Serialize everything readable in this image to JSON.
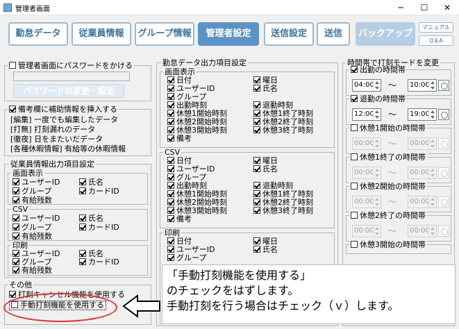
{
  "window": {
    "title": "管理者画面"
  },
  "toolbar": {
    "kintai": "勤怠データ",
    "employee": "従業員情報",
    "group": "グループ情報",
    "admin": "管理者設定",
    "send_settings": "送信設定",
    "send": "送信",
    "backup": "バックアップ",
    "manual": "マニュアル",
    "qa": "Q＆A"
  },
  "password": {
    "label": "管理者画面にパスワードをかける",
    "change_button": "パスワードの変更・設定"
  },
  "remarks": {
    "label": "備考欄に補助情報を挿入する",
    "lines": [
      "[編集]  一度でも編集したデータ",
      "[打無]  打刻漏れのデータ",
      "[徹夜]  日をまたいだデータ",
      "[各種休暇情報]  有給等の休暇情報"
    ]
  },
  "employee_output": {
    "title": "従業員情報出力項目設定",
    "screen": {
      "title": "画面表示",
      "user_id": "ユーザーID",
      "name": "氏名",
      "group": "グループ",
      "card_id": "カードID",
      "paid_leave": "有給残数"
    },
    "csv": {
      "title": "CSV",
      "user_id": "ユーザーID",
      "name": "氏名",
      "group": "グループ",
      "card_id": "カードID",
      "paid_leave": "有給残数"
    },
    "print": {
      "title": "印刷",
      "user_id": "ユーザーID",
      "name": "氏名",
      "group": "グループ",
      "card_id": "カードID",
      "paid_leave": "有給残数"
    }
  },
  "other": {
    "title": "その他",
    "cancel_label": "打刻キャンセル機能を使用する",
    "manual_label": "手動打刻機能を使用する"
  },
  "kintai_output": {
    "title": "勤怠データ出力項目設定",
    "screen": {
      "title": "画面表示",
      "left": [
        "日付",
        "ユーザーID",
        "グループ",
        "出勤時刻",
        "休憩1開始時刻",
        "休憩2開始時刻",
        "休憩3開始時刻",
        "備考"
      ],
      "right": [
        "曜日",
        "氏名",
        "",
        "退勤時刻",
        "休憩1終了時刻",
        "休憩2終了時刻",
        "休憩3終了時刻"
      ]
    },
    "csv": {
      "title": "CSV",
      "left": [
        "日付",
        "ユーザーID",
        "グループ",
        "出勤時刻",
        "休憩1開始時刻",
        "休憩2開始時刻",
        "休憩3開始時刻",
        "備考"
      ],
      "right": [
        "曜日",
        "氏名",
        "",
        "退勤時刻",
        "休憩1終了時刻",
        "休憩2終了時刻",
        "休憩3終了時刻"
      ]
    },
    "print": {
      "title": "印刷",
      "left": [
        "日付",
        "ユーザーID",
        "グループ"
      ],
      "right": [
        "曜日",
        "氏名"
      ]
    }
  },
  "time_mode": {
    "title": "時間帯で打刻モードを変更",
    "tilde": "～",
    "rows": [
      {
        "label": "出勤の時間帯",
        "from": "04:00",
        "to": "10:00"
      },
      {
        "label": "退勤の時間帯",
        "from": "12:00",
        "to": "19:00"
      },
      {
        "label": "休憩1開始の時間帯",
        "from": "00:00",
        "to": "00:00"
      },
      {
        "label": "休憩1終了の時間帯",
        "from": "00:00",
        "to": "00:00"
      },
      {
        "label": "休憩2開始の時間帯",
        "from": "00:00",
        "to": "00:00"
      },
      {
        "label": "休憩2終了の時間帯",
        "from": "00:00",
        "to": "00:00"
      },
      {
        "label": "休憩3開始の時間帯",
        "from": "",
        "to": ""
      }
    ]
  },
  "callout": {
    "line1": "「手動打刻機能を使用する」",
    "line2": "のチェックをはずします。",
    "line3": "手動打刻を行う場合はチェック（ｖ）します。"
  },
  "colors": {
    "accent": "#5b93c5",
    "highlight": "#e03030"
  }
}
